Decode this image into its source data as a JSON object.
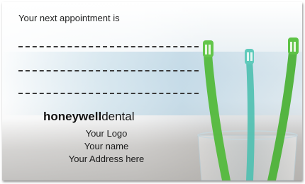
{
  "card": {
    "heading": "Your next appointment is",
    "brand_bold": "honeywell",
    "brand_light": "dental",
    "lines": [
      "Your Logo",
      "Your name",
      "Your Address here"
    ]
  },
  "image": {
    "subject": "toothbrushes in a glass",
    "colors": {
      "brush_green": "#4fb83a",
      "brush_teal": "#3fb7a6",
      "glass": "#d9e4e8"
    }
  }
}
